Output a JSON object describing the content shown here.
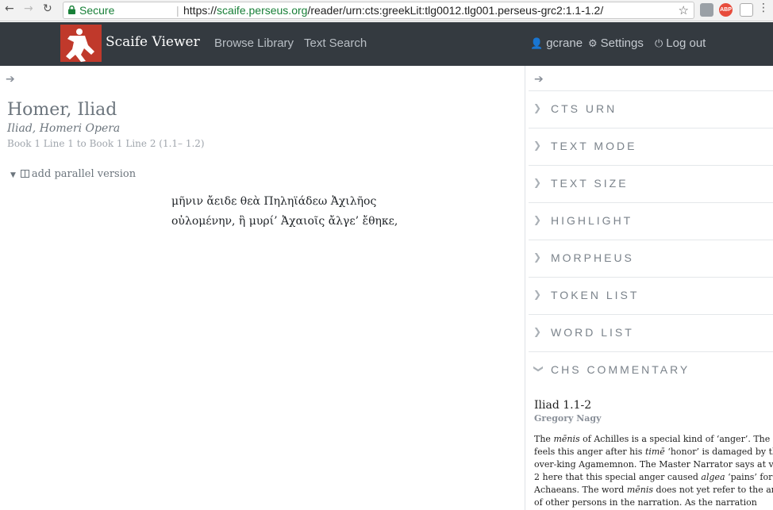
{
  "browser": {
    "secure_label": "Secure",
    "url_scheme": "https://",
    "url_host": "scaife.perseus.org",
    "url_path": "/reader/urn:cts:greekLit:tlg0012.tlg001.perseus-grc2:1.1-1.2/",
    "ext_abp": "ABP"
  },
  "navbar": {
    "brand": "Scaife Viewer",
    "links": [
      "Browse Library",
      "Text Search"
    ],
    "user": "gcrane",
    "settings": "Settings",
    "logout": "Log out"
  },
  "reader": {
    "title": "Homer, Iliad",
    "subtitle": "Iliad, Homeri Opera",
    "range": "Book 1 Line 1 to Book 1 Line 2 (1.1– 1.2)",
    "parallel_label": "add parallel version",
    "lines": [
      "μῆνιν ἄειδε θεὰ Πηληϊάδεω Ἀχιλῆος",
      "οὐλομένην, ἣ μυρί’ Ἀχαιοῖς ἄλγε’ ἔθηκε,"
    ]
  },
  "sidebar": {
    "widgets": [
      "CTS URN",
      "TEXT MODE",
      "TEXT SIZE",
      "HIGHLIGHT",
      "MORPHEUS",
      "TOKEN LIST",
      "WORD LIST",
      "CHS COMMENTARY"
    ],
    "commentary": {
      "title": "Iliad 1.1-2",
      "author": "Gregory Nagy",
      "lines": [
        [
          "The ",
          "mēnis",
          " of Achilles is a special kind of ‘anger’. The hero"
        ],
        [
          "feels this anger after his ",
          "timē",
          " ‘honor’ is damaged by the"
        ],
        [
          "over-king Agamemnon. The Master Narrator says at verse",
          "",
          ""
        ],
        [
          "2 here that this special anger caused ",
          "algea",
          " ‘pains’ for the"
        ],
        [
          "Achaeans. The word ",
          "mēnis",
          " does not yet refer to the anger"
        ],
        [
          "of other persons in the narration. As the narration",
          "",
          ""
        ]
      ]
    }
  }
}
